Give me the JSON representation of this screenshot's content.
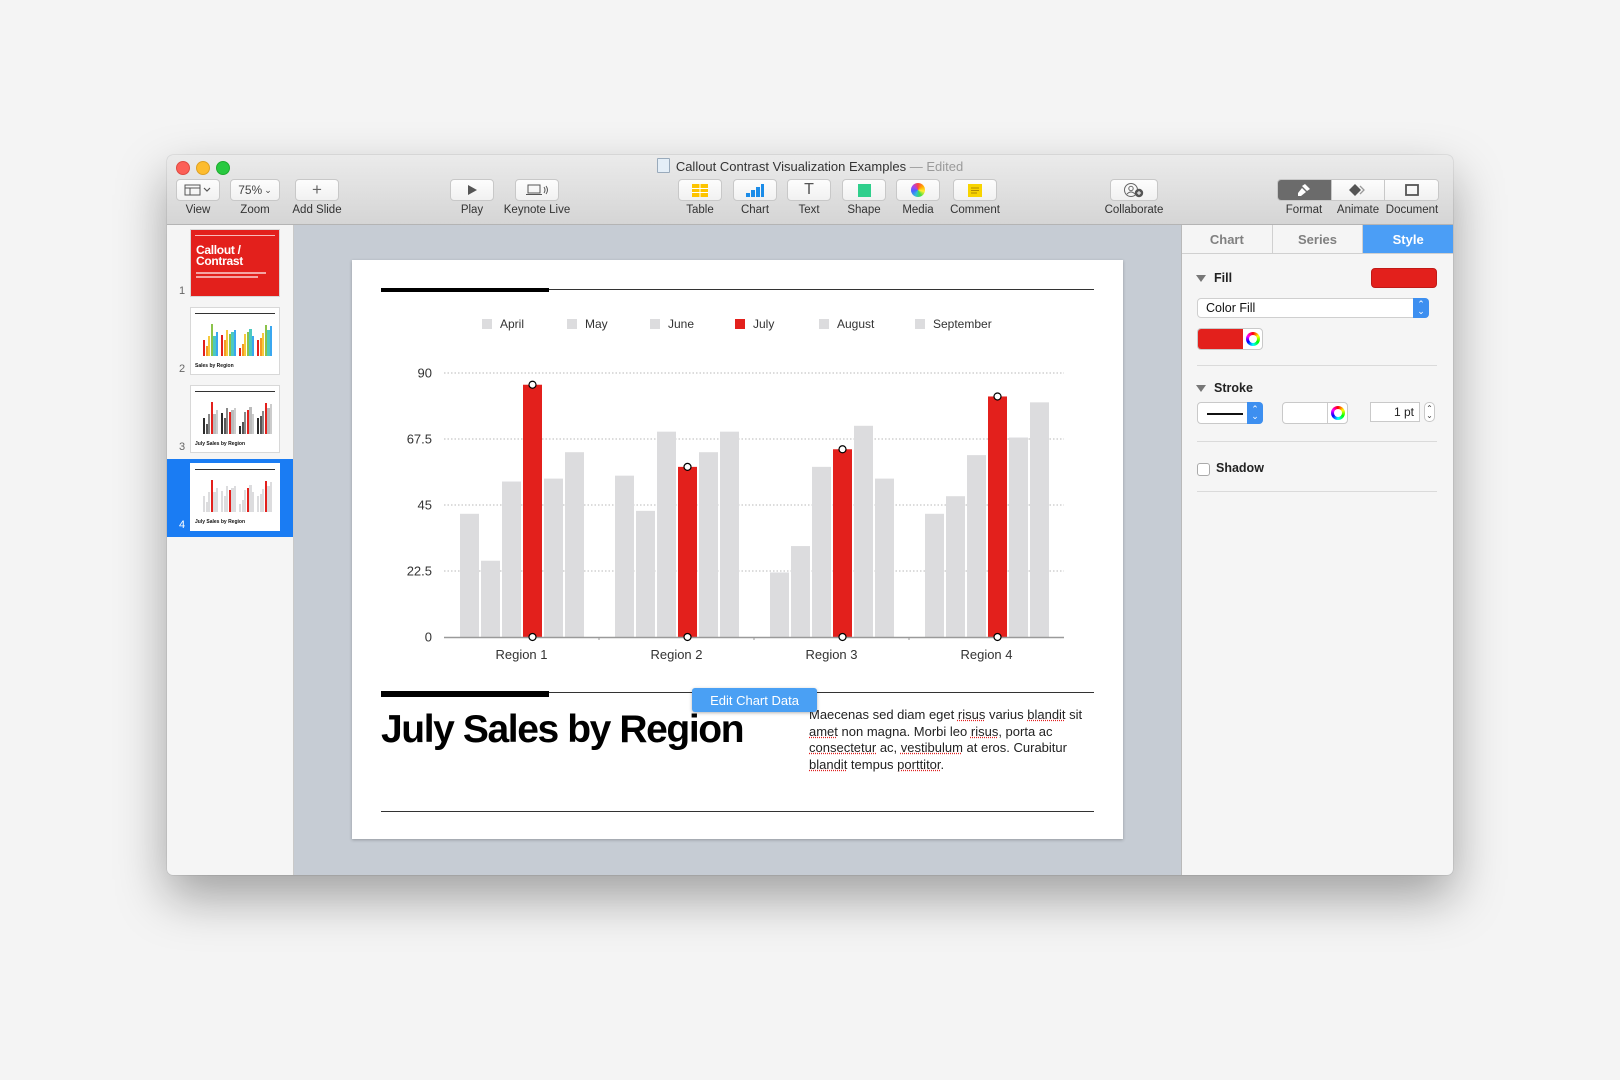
{
  "window": {
    "title": "Callout Contrast Visualization Examples",
    "title_separator": " — ",
    "status": "Edited",
    "status_chevron": "⌄"
  },
  "toolbar": {
    "view": {
      "label": "View",
      "icon": "sidebar-view-icon"
    },
    "zoom": {
      "label": "Zoom",
      "value": "75%"
    },
    "add_slide": {
      "label": "Add Slide",
      "icon": "plus-icon"
    },
    "play": {
      "label": "Play",
      "icon": "play-icon"
    },
    "keynote_live": {
      "label": "Keynote Live",
      "icon": "keynote-live-icon"
    },
    "table": {
      "label": "Table",
      "icon": "table-icon"
    },
    "chart": {
      "label": "Chart",
      "icon": "chart-icon"
    },
    "text": {
      "label": "Text",
      "icon": "text-icon",
      "glyph": "T"
    },
    "shape": {
      "label": "Shape",
      "icon": "shape-icon"
    },
    "media": {
      "label": "Media",
      "icon": "media-icon"
    },
    "comment": {
      "label": "Comment",
      "icon": "comment-icon"
    },
    "collaborate": {
      "label": "Collaborate",
      "icon": "collaborate-icon"
    },
    "format": {
      "label": "Format",
      "icon": "paintbrush-icon",
      "active": true
    },
    "animate": {
      "label": "Animate",
      "icon": "animate-icon"
    },
    "document": {
      "label": "Document",
      "icon": "document-icon"
    }
  },
  "slides": [
    {
      "number": "1",
      "title": "Callout / Contrast",
      "selected": false
    },
    {
      "number": "2",
      "title": "Sales by Region",
      "selected": false
    },
    {
      "number": "3",
      "title": "July Sales by Region",
      "selected": false
    },
    {
      "number": "4",
      "title": "July Sales by Region",
      "selected": true
    }
  ],
  "slide": {
    "title": "July Sales by Region",
    "body_parts": [
      {
        "t": "Maecenas sed diam eget ",
        "sq": false
      },
      {
        "t": "risus",
        "sq": true
      },
      {
        "t": " varius ",
        "sq": false
      },
      {
        "t": "blandit",
        "sq": true
      },
      {
        "t": " sit ",
        "sq": false
      },
      {
        "t": "amet",
        "sq": true
      },
      {
        "t": " non magna. Morbi leo ",
        "sq": false
      },
      {
        "t": "risus",
        "sq": true
      },
      {
        "t": ", porta ac ",
        "sq": false
      },
      {
        "t": "consectetur",
        "sq": true
      },
      {
        "t": " ac, ",
        "sq": false
      },
      {
        "t": "vestibulum",
        "sq": true
      },
      {
        "t": " at eros. Curabitur ",
        "sq": false
      },
      {
        "t": "blandit",
        "sq": true
      },
      {
        "t": " tempus ",
        "sq": false
      },
      {
        "t": "porttitor",
        "sq": true
      },
      {
        "t": ".",
        "sq": false
      }
    ],
    "edit_chart_button": "Edit Chart Data"
  },
  "chart_data": {
    "type": "bar",
    "title": "",
    "xlabel": "",
    "ylabel": "",
    "categories": [
      "Region 1",
      "Region 2",
      "Region 3",
      "Region 4"
    ],
    "ylim": [
      0,
      90
    ],
    "yticks": [
      0,
      22.5,
      45,
      67.5,
      90
    ],
    "ytick_labels": [
      "0",
      "22.5",
      "45",
      "67.5",
      "90"
    ],
    "grid": true,
    "legend_position": "top",
    "highlight_series": "July",
    "colors": {
      "muted": "#dcdcde",
      "highlight": "#e3201c"
    },
    "series": [
      {
        "name": "April",
        "values": [
          42,
          55,
          22,
          42
        ]
      },
      {
        "name": "May",
        "values": [
          26,
          43,
          31,
          48
        ]
      },
      {
        "name": "June",
        "values": [
          53,
          70,
          58,
          62
        ]
      },
      {
        "name": "July",
        "values": [
          86,
          58,
          64,
          82
        ]
      },
      {
        "name": "August",
        "values": [
          54,
          63,
          72,
          68
        ]
      },
      {
        "name": "September",
        "values": [
          63,
          70,
          54,
          80
        ]
      }
    ]
  },
  "inspector": {
    "tabs": [
      {
        "label": "Chart",
        "active": false
      },
      {
        "label": "Series",
        "active": false
      },
      {
        "label": "Style",
        "active": true
      }
    ],
    "fill": {
      "label": "Fill",
      "color": "#e3201c",
      "type": "Color Fill"
    },
    "stroke": {
      "label": "Stroke",
      "width": "1 pt"
    },
    "shadow": {
      "label": "Shadow",
      "checked": false
    }
  }
}
